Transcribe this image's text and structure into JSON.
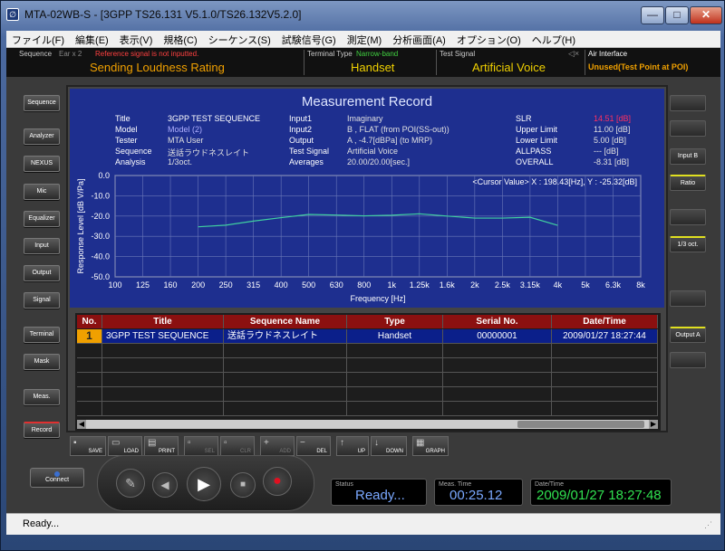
{
  "window": {
    "title": "MTA-02WB-S - [3GPP TS26.131 V5.1.0/TS26.132V5.2.0]",
    "min": "—",
    "max": "□",
    "close": "✕"
  },
  "menu": [
    "ファイル(F)",
    "編集(E)",
    "表示(V)",
    "規格(C)",
    "シーケンス(S)",
    "試験信号(G)",
    "測定(M)",
    "分析画面(A)",
    "オプション(O)",
    "ヘルプ(H)"
  ],
  "infobar": {
    "sequence_label": "Sequence",
    "ear_label": "Ear x 2",
    "warning": "Reference signal is not inputted.",
    "sequence_value": "Sending Loudness Rating",
    "terminal_label": "Terminal Type",
    "terminal_band": "Narrow-band",
    "terminal_value": "Handset",
    "signal_label": "Test Signal",
    "signal_value": "Artificial Voice",
    "air_label": "Air Interface",
    "air_value": "Unused(Test Point at POI)"
  },
  "left_buttons": [
    "Sequence",
    "Analyzer",
    "NEXUS",
    "Mic",
    "Equalizer",
    "Input",
    "Output",
    "Signal",
    "Terminal",
    "Mask",
    "Meas.",
    "Record"
  ],
  "right_buttons": [
    "",
    "",
    "Input B",
    "Ratio",
    "",
    "1/3 oct.",
    "",
    "Output A",
    ""
  ],
  "record": {
    "title": "Measurement Record",
    "fields": [
      {
        "label": "Title",
        "value": "3GPP TEST SEQUENCE"
      },
      {
        "label": "Model",
        "value": "Model (2)"
      },
      {
        "label": "Tester",
        "value": "MTA User"
      },
      {
        "label": "Sequence",
        "value": "送話ラウドネスレイト"
      },
      {
        "label": "Analysis",
        "value": "1/3oct."
      }
    ],
    "fields2": [
      {
        "label": "Input1",
        "value": "Imaginary"
      },
      {
        "label": "Input2",
        "value": "B , FLAT (from POI(SS-out))"
      },
      {
        "label": "Output",
        "value": "A , -4.7[dBPa] (to MRP)"
      },
      {
        "label": "Test Signal",
        "value": "Artificial Voice"
      },
      {
        "label": "Averages",
        "value": "20.00/20.00[sec.]"
      }
    ],
    "fields3": [
      {
        "label": "SLR",
        "value": "14.51 [dB]"
      },
      {
        "label": "Upper Limit",
        "value": "11.00 [dB]"
      },
      {
        "label": "Lower Limit",
        "value": "5.00 [dB]"
      },
      {
        "label": "ALLPASS",
        "value": "--- [dB]"
      },
      {
        "label": "OVERALL",
        "value": "-8.31 [dB]"
      }
    ],
    "cursor": "<Cursor Value> X : 198.43[Hz], Y : -25.32[dB]"
  },
  "chart_data": {
    "type": "line",
    "xlabel": "Frequency [Hz]",
    "ylabel": "Response Level [dB V/Pa]",
    "ylim": [
      -50,
      0
    ],
    "yticks": [
      "0.0",
      "-10.0",
      "-20.0",
      "-30.0",
      "-40.0",
      "-50.0"
    ],
    "x": [
      "100",
      "125",
      "160",
      "200",
      "250",
      "315",
      "400",
      "500",
      "630",
      "800",
      "1k",
      "1.25k",
      "1.6k",
      "2k",
      "2.5k",
      "3.15k",
      "4k",
      "5k",
      "6.3k",
      "8k"
    ],
    "grid": true,
    "series": [
      {
        "values": [
          null,
          null,
          null,
          -25.3,
          -24.5,
          -22.5,
          -20.8,
          -19.2,
          -19.5,
          -19.9,
          -19.6,
          -18.9,
          -20.0,
          -21.0,
          -21.0,
          -20.6,
          -24.6,
          null,
          null,
          null
        ]
      }
    ]
  },
  "table": {
    "headers": [
      "No.",
      "Title",
      "Sequence Name",
      "Type",
      "Serial No.",
      "Date/Time"
    ],
    "rows": [
      [
        "1",
        "3GPP TEST SEQUENCE",
        "送話ラウドネスレイト",
        "Handset",
        "00000001",
        "2009/01/27 18:27:44"
      ]
    ]
  },
  "toolbar": [
    "SAVE",
    "LOAD",
    "PRINT",
    "SEL",
    "CLR",
    "ADD",
    "DEL",
    "UP",
    "DOWN",
    "GRAPH"
  ],
  "bottom": {
    "connect": "Connect",
    "status_label": "Status",
    "status_value": "Ready...",
    "meas_label": "Meas. Time",
    "meas_value": "00:25.12",
    "date_label": "Date/Time",
    "date_value": "2009/01/27 18:27:48"
  },
  "statusbar": "Ready...",
  "colors": {
    "accent": "#1e2f8f",
    "warning": "#ff4040",
    "highlight": "#f0a000",
    "table_header": "#8b1010",
    "selected_row": "#0b1f8a"
  }
}
